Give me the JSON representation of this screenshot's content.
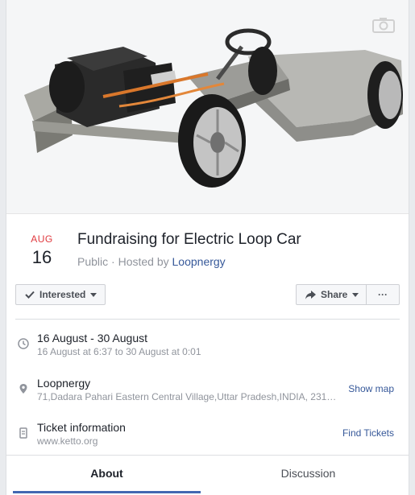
{
  "event": {
    "month": "AUG",
    "day": "16",
    "title": "Fundraising for Electric Loop Car",
    "privacy": "Public",
    "hosted_by_prefix": "· Hosted by",
    "host": "Loopnergy"
  },
  "actions": {
    "interested_label": "Interested",
    "share_label": "Share",
    "more_label": "···"
  },
  "details": {
    "time": {
      "primary": "16 August - 30 August",
      "secondary": "16 August at 6:37 to 30 August at 0:01",
      "icon": "clock-icon"
    },
    "location": {
      "primary": "Loopnergy",
      "secondary": "71,Dadara Pahari Eastern Central Village,Uttar Pradesh,INDIA, 231…",
      "action": "Show map",
      "icon": "location-pin-icon"
    },
    "tickets": {
      "primary": "Ticket information",
      "secondary": "www.ketto.org",
      "action": "Find Tickets",
      "icon": "ticket-icon"
    }
  },
  "tabs": [
    {
      "label": "About",
      "active": true
    },
    {
      "label": "Discussion",
      "active": false
    }
  ],
  "colors": {
    "month_red": "#e0393e",
    "link_blue": "#365899",
    "tab_underline": "#4267b2"
  }
}
